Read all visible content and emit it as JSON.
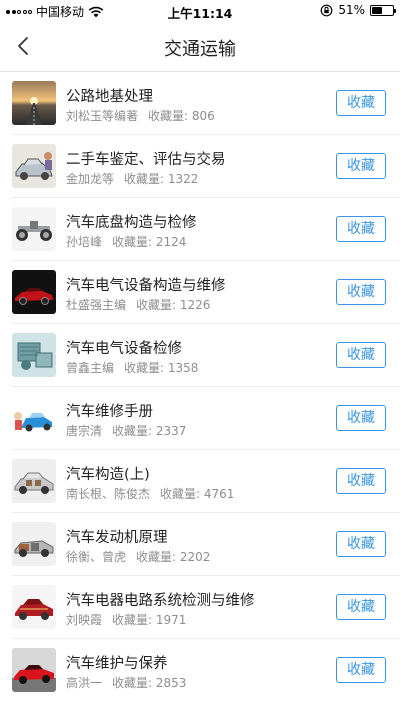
{
  "status_bar": {
    "carrier": "中国移动",
    "time": "上午11:14",
    "battery": "51%",
    "battery_level": 0.51
  },
  "nav": {
    "title": "交通运输",
    "back_icon": "chevron-left-icon"
  },
  "books": [
    {
      "title": "公路地基处理",
      "author": "刘松玉等编著",
      "fav_label": "收藏量:",
      "fav_count": "806",
      "button": "收藏",
      "thumb": "road-sunset"
    },
    {
      "title": "二手车鉴定、评估与交易",
      "author": "金加龙等",
      "fav_label": "收藏量:",
      "fav_count": "1322",
      "button": "收藏",
      "thumb": "car-sketch"
    },
    {
      "title": "汽车底盘构造与检修",
      "author": "孙培峰",
      "fav_label": "收藏量:",
      "fav_count": "2124",
      "button": "收藏",
      "thumb": "chassis"
    },
    {
      "title": "汽车电气设备构造与维修",
      "author": "杜盛强主编",
      "fav_label": "收藏量:",
      "fav_count": "1226",
      "button": "收藏",
      "thumb": "red-car-dark"
    },
    {
      "title": "汽车电气设备检修",
      "author": "曾鑫主编",
      "fav_label": "收藏量:",
      "fav_count": "1358",
      "button": "收藏",
      "thumb": "engine-parts"
    },
    {
      "title": "汽车维修手册",
      "author": "唐宗清",
      "fav_label": "收藏量:",
      "fav_count": "2337",
      "button": "收藏",
      "thumb": "blue-car-cartoon"
    },
    {
      "title": "汽车构造(上)",
      "author": "南长根、陈俊杰",
      "fav_label": "收藏量:",
      "fav_count": "4761",
      "button": "收藏",
      "thumb": "car-cutaway"
    },
    {
      "title": "汽车发动机原理",
      "author": "徐衡、曾虎",
      "fav_label": "收藏量:",
      "fav_count": "2202",
      "button": "收藏",
      "thumb": "engine-cutaway"
    },
    {
      "title": "汽车电器电路系统检测与维修",
      "author": "刘映霞",
      "fav_label": "收藏量:",
      "fav_count": "1971",
      "button": "收藏",
      "thumb": "red-car-xray"
    },
    {
      "title": "汽车维护与保养",
      "author": "高洪一",
      "fav_label": "收藏量:",
      "fav_count": "2853",
      "button": "收藏",
      "thumb": "red-sports-car"
    }
  ]
}
